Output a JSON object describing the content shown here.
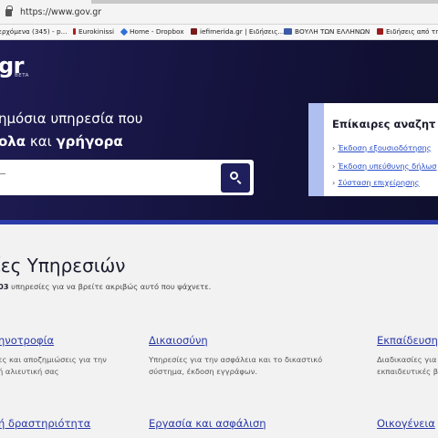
{
  "browser": {
    "url": "https://www.gov.gr",
    "bookmarks": [
      {
        "label": "ερχόμενα (345) - p...",
        "color": "#c23b22"
      },
      {
        "label": "Eurokinissi",
        "color": "#b01c1c"
      },
      {
        "label": "Home - Dropbox",
        "color": "#2f6fd6"
      },
      {
        "label": "iefimerida.gr | Ειδήσεις...",
        "color": "#7a1a1a"
      },
      {
        "label": "ΒΟΥΛΗ ΤΩΝ ΕΛΛΗΝΩΝ",
        "color": "#3b5ba8"
      },
      {
        "label": "Ειδήσεις από τη",
        "color": "#9c1b1b"
      }
    ]
  },
  "hero": {
    "logo": "gr",
    "beta": "BETA",
    "headline_line1": "ημόσια υπηρεσία που",
    "headline_line2_bold1": "ολα",
    "headline_line2_mid": " και ",
    "headline_line2_bold2": "γρήγορα",
    "search_button_icon": "search-icon"
  },
  "popular": {
    "title": "Επίκαιρες αναζητ",
    "links": [
      "Έκδοση εξουσιοδότησης",
      "Έκδοση υπεύθυνης δήλωσ",
      "Σύσταση επιχείρησης"
    ]
  },
  "categories": {
    "title": "ίες Υπηρεσιών",
    "subtitle_count": "03",
    "subtitle_rest": " υπηρεσίες για να βρείτε ακριβώς αυτό που ψάχνετε.",
    "cards": [
      {
        "title": "ηνοτροφία",
        "desc1": "ες και αποζημιώσεις για την",
        "desc2": "ή αλιευτική σας"
      },
      {
        "title": "Δικαιοσύνη",
        "desc1": "Υπηρεσίες για την ασφάλεια και το δικαστικό",
        "desc2": "σύστημα, έκδοση εγγράφων."
      },
      {
        "title": "Εκπαίδευση",
        "desc1": "Διαδικασίες για",
        "desc2": "εκπαιδευτικές β"
      },
      {
        "title": "ή δραστηριότητα",
        "desc1": "",
        "desc2": ""
      },
      {
        "title": "Εργασία και ασφάλιση",
        "desc1": "",
        "desc2": ""
      },
      {
        "title": "Οικογένεια",
        "desc1": "",
        "desc2": ""
      }
    ]
  },
  "colors": {
    "hero_bg": "#16153f",
    "accent_blue": "#2a39a6",
    "link_blue": "#2a4fc9",
    "popular_bar": "#aebff0"
  }
}
